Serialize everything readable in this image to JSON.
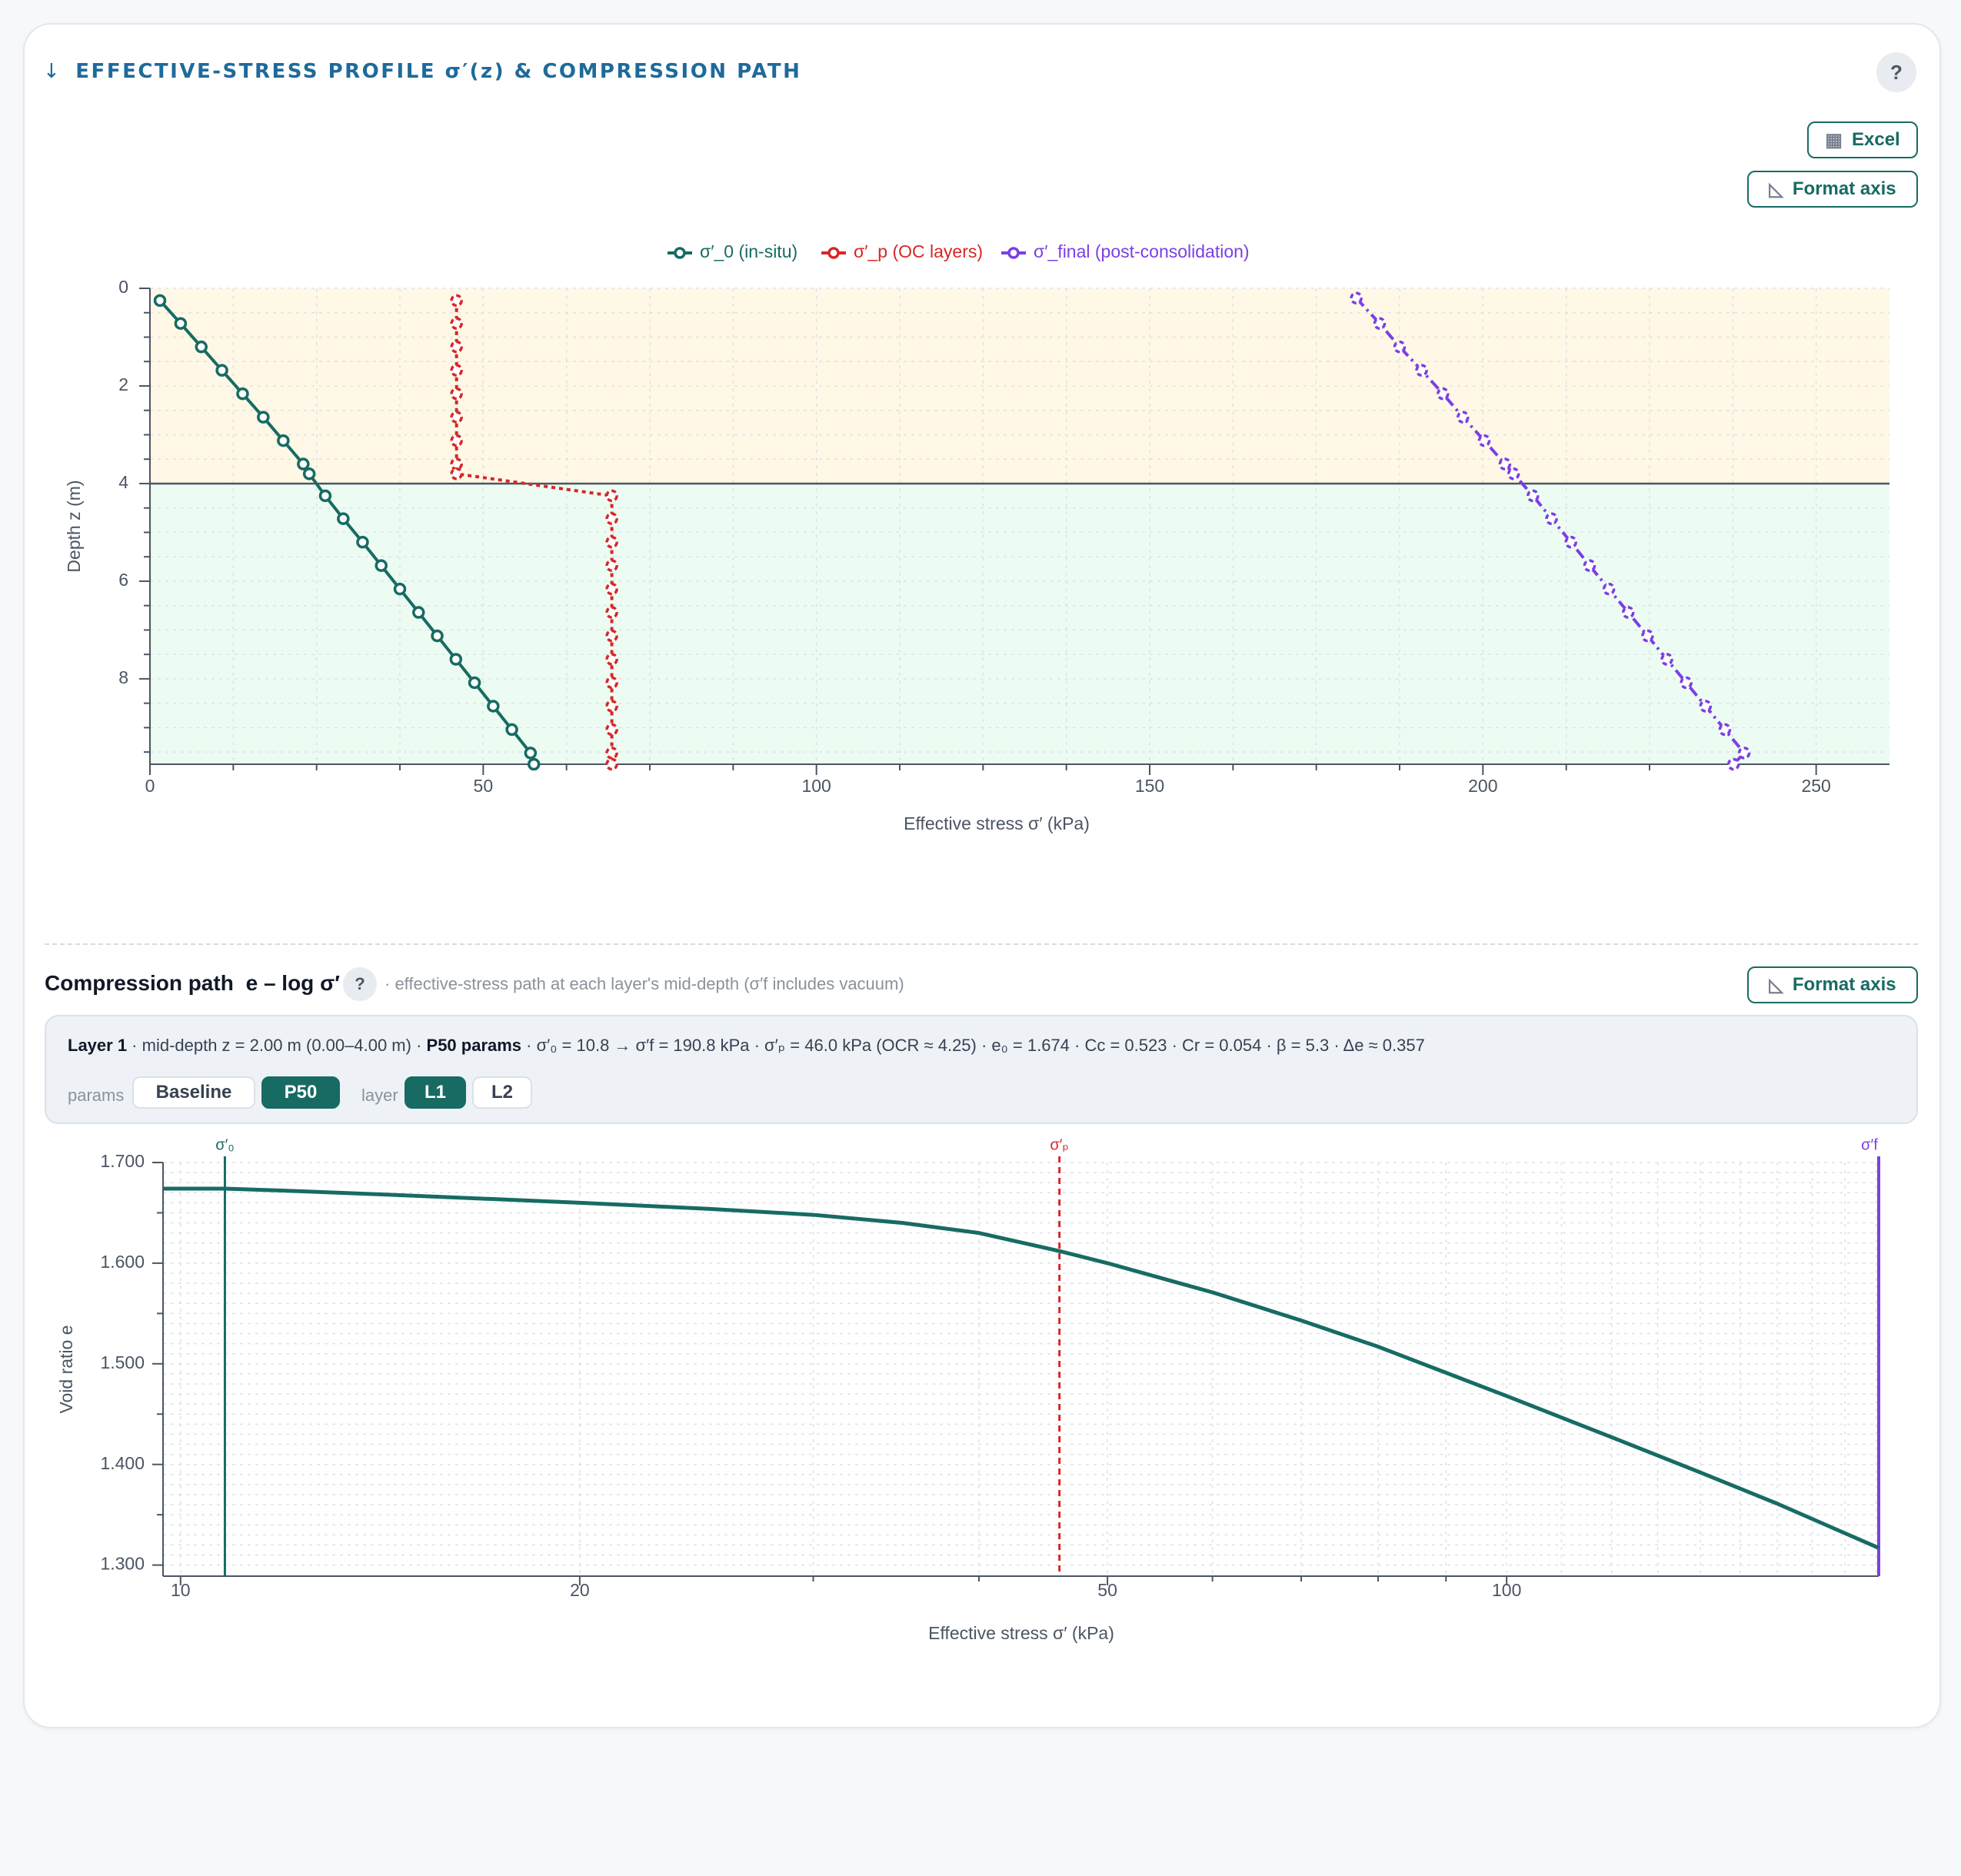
{
  "card": {
    "arrow": "↓",
    "title": "EFFECTIVE-STRESS PROFILE σ′(z) & COMPRESSION PATH",
    "help": "?"
  },
  "toolbar": {
    "excel_label": "Excel",
    "format_axis_label": "Format axis"
  },
  "compression": {
    "title": "Compression path",
    "title_sub": "e – log σ′",
    "help": "?",
    "description": "· effective-stress path at each layer's mid-depth (σ′f includes vacuum)",
    "format_axis_label": "Format axis",
    "info": {
      "layer": "Layer 1",
      "middepth": " · mid-depth z = 2.00 m (0.00–4.00 m) · ",
      "params": "P50 params",
      "rest": " · σ′₀ = 10.8 → σ′f = 190.8 kPa · σ′ₚ = 46.0 kPa (OCR ≈ 4.25) · e₀ = 1.674 · Cc = 0.523 · Cr = 0.054 · β = 5.3 · Δe ≈ 0.357"
    },
    "controls": {
      "params_label": "params",
      "params_options": [
        "Baseline",
        "P50"
      ],
      "params_selected": "P50",
      "layer_label": "layer",
      "layer_options": [
        "L1",
        "L2"
      ],
      "layer_selected": "L1"
    }
  },
  "colors": {
    "teal": "#176b63",
    "red": "#d62728",
    "purple": "#7b3fe4",
    "layer1_fill": "#fff8e6",
    "layer2_fill": "#edfcf2"
  },
  "chart_data": [
    {
      "type": "line",
      "xlabel": "Effective stress σ′ (kPa)",
      "ylabel": "Depth z (m)",
      "xlim": [
        0,
        261
      ],
      "ylim": [
        9.75,
        0
      ],
      "x_ticks": [
        0,
        50,
        100,
        150,
        200,
        250
      ],
      "y_ticks": [
        0,
        2,
        4,
        6,
        8
      ],
      "grid": true,
      "legend_position": "top",
      "layer_boundaries": [
        0,
        4,
        9.75
      ],
      "series": [
        {
          "name": "σ′_0 (in-situ)",
          "color": "#176b63",
          "style": "solid",
          "marker": "circle",
          "z": [
            0.25,
            0.72,
            1.2,
            1.68,
            2.16,
            2.64,
            3.12,
            3.6,
            3.8,
            4.25,
            4.72,
            5.2,
            5.68,
            6.16,
            6.64,
            7.12,
            7.6,
            8.08,
            8.56,
            9.04,
            9.52,
            9.75
          ],
          "sigma": [
            1.5,
            4.6,
            7.7,
            10.8,
            13.9,
            17.0,
            20.0,
            23.0,
            23.9,
            26.3,
            29.0,
            31.9,
            34.7,
            37.5,
            40.3,
            43.1,
            45.9,
            48.7,
            51.5,
            54.3,
            57.1,
            57.6
          ]
        },
        {
          "name": "σ′_p (OC layers)",
          "color": "#d62728",
          "style": "dotted",
          "marker": "circle",
          "z": [
            0.25,
            0.72,
            1.2,
            1.68,
            2.16,
            2.64,
            3.12,
            3.6,
            3.8,
            4.25,
            4.72,
            5.2,
            5.68,
            6.16,
            6.64,
            7.12,
            7.6,
            8.08,
            8.56,
            9.04,
            9.52,
            9.75
          ],
          "sigma": [
            46.0,
            46.0,
            46.0,
            46.0,
            46.0,
            46.0,
            46.0,
            46.0,
            46.0,
            69.3,
            69.3,
            69.3,
            69.3,
            69.3,
            69.3,
            69.3,
            69.3,
            69.3,
            69.3,
            69.3,
            69.3,
            69.3
          ]
        },
        {
          "name": "σ′_final (post-consolidation)",
          "color": "#7b3fe4",
          "style": "dashdot",
          "marker": "circle",
          "z": [
            0.2,
            0.72,
            1.2,
            1.68,
            2.16,
            2.64,
            3.12,
            3.6,
            3.8,
            4.25,
            4.72,
            5.2,
            5.68,
            6.16,
            6.64,
            7.12,
            7.6,
            8.08,
            8.56,
            9.04,
            9.52,
            9.75
          ],
          "sigma": [
            181.0,
            184.5,
            187.5,
            190.8,
            194.0,
            197.0,
            200.2,
            203.3,
            204.6,
            207.5,
            210.3,
            213.2,
            216.0,
            218.9,
            221.8,
            224.7,
            227.6,
            230.5,
            233.4,
            236.3,
            239.2,
            237.6
          ]
        }
      ]
    },
    {
      "type": "line",
      "xlabel": "Effective stress σ′ (kPa)",
      "ylabel": "Void ratio e",
      "x_scale": "log",
      "xlim": [
        9.7,
        190.8
      ],
      "ylim": [
        1.289,
        1.7
      ],
      "x_ticks": [
        10,
        20,
        50,
        100
      ],
      "y_ticks": [
        1.7,
        1.6,
        1.5,
        1.4,
        1.3
      ],
      "y_tick_labels": [
        "1.700",
        "1.600",
        "1.500",
        "1.400",
        "1.300"
      ],
      "grid": true,
      "series": [
        {
          "name": "e",
          "color": "#176b63",
          "sigma": [
            9.7,
            10.8,
            12,
            15,
            20,
            25,
            30,
            35,
            40,
            46,
            50,
            60,
            70,
            80,
            100,
            120,
            140,
            160,
            190.8
          ],
          "e": [
            1.674,
            1.674,
            1.672,
            1.667,
            1.66,
            1.654,
            1.648,
            1.64,
            1.63,
            1.612,
            1.6,
            1.571,
            1.543,
            1.517,
            1.468,
            1.427,
            1.392,
            1.361,
            1.317
          ]
        }
      ],
      "vlines": [
        {
          "label": "σ′₀",
          "x": 10.8,
          "color": "#176b63",
          "style": "solid"
        },
        {
          "label": "σ′ₚ",
          "x": 46.0,
          "color": "#d62728",
          "style": "dashed"
        },
        {
          "label": "σ′f",
          "x": 190.8,
          "color": "#7b3fe4",
          "style": "solid"
        }
      ]
    }
  ]
}
